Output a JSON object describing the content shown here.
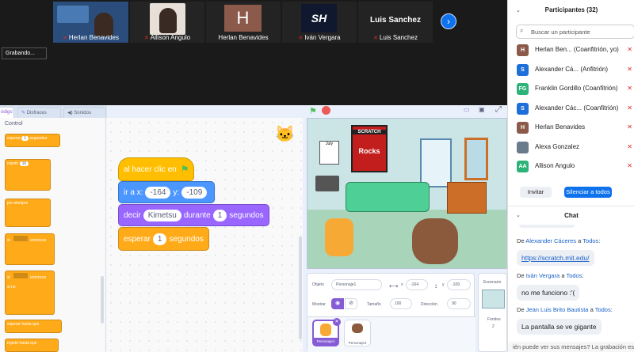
{
  "videos": [
    {
      "name": "Herlan Benavides"
    },
    {
      "name": "Allison Angulo"
    },
    {
      "name": "Herlan Benavides",
      "initial": "H"
    },
    {
      "name": "Iván Vergara",
      "initial": "SH"
    },
    {
      "name": "Luis Sanchez",
      "display": "Luis Sanchez"
    }
  ],
  "recording": "Grabando...",
  "scratch": {
    "tabs": [
      "ódigo",
      "Disfraces",
      "Sonidos"
    ],
    "category": "Control",
    "palette": [
      "esperar",
      "segundos",
      "1",
      "repetir",
      "10",
      "por siempre",
      "si",
      "entonces",
      "si",
      "entonces",
      "si no",
      "esperar hasta que",
      "repetir hasta que"
    ],
    "blocks": {
      "event": "al hacer clic en",
      "goto": "ir a x:",
      "gx": "-164",
      "gy_label": "y:",
      "gy": "-109",
      "say": "decir",
      "say_val": "Kimetsu",
      "say_mid": "durante",
      "say_num": "1",
      "say_end": "segundos",
      "wait": "esperar",
      "wait_num": "1",
      "wait_end": "segundos"
    },
    "stage_text": {
      "poster1": "SCRATCH",
      "poster2": "Rocks",
      "cal": "July"
    },
    "sprite_info": {
      "obj_label": "Objeto",
      "obj_val": "Personaje1",
      "x_label": "x",
      "x_val": "-164",
      "y_label": "y",
      "y_val": "-109",
      "show_label": "Mostrar",
      "size_label": "Tamaño",
      "size_val": "100",
      "dir_label": "Dirección",
      "dir_val": "90",
      "sprites": [
        "Personaje1",
        "Personaje2"
      ]
    },
    "stage_panel": {
      "label": "Escenario",
      "fondos": "Fondos",
      "fondos_num": "2"
    }
  },
  "participants": {
    "title": "Participantes (32)",
    "search": "Buscar un participante",
    "list": [
      {
        "initial": "H",
        "color": "#8c5a4a",
        "name": "Herlan Ben... (Coanfitrión, yo)"
      },
      {
        "initial": "S",
        "color": "#1e6fd9",
        "name": "Alexander Cá... (Anfitrión)"
      },
      {
        "initial": "FG",
        "color": "#2db37a",
        "name": "Franklin Gordillo (Coanfitrión)"
      },
      {
        "initial": "S",
        "color": "#1e6fd9",
        "name": "Alexander Các... (Coanfitrión)"
      },
      {
        "initial": "H",
        "color": "#8c5a4a",
        "name": "Herlan Benavides"
      },
      {
        "initial": "",
        "color": "#6a7b8c",
        "name": "Alexa Gonzalez"
      },
      {
        "initial": "AA",
        "color": "#2db37a",
        "name": "Allison Angulo"
      }
    ],
    "invite": "Invitar",
    "mute_all": "Silenciar a todos"
  },
  "chat": {
    "title": "Chat",
    "messages": [
      {
        "from": "Alexander Cáceres",
        "to": "Todos",
        "text": "https://scratch.mit.edu/"
      },
      {
        "from": "Iván Vergara",
        "to": "Todos",
        "text": "no me funciono :'("
      },
      {
        "from": "Jean Luis Brito Bautista",
        "to": "Todos",
        "text": "La pantalla se ve gigante"
      }
    ],
    "prefix": "De",
    "joiner": "a",
    "footer": "ién puede ver sus mensajes? La grabación est"
  }
}
